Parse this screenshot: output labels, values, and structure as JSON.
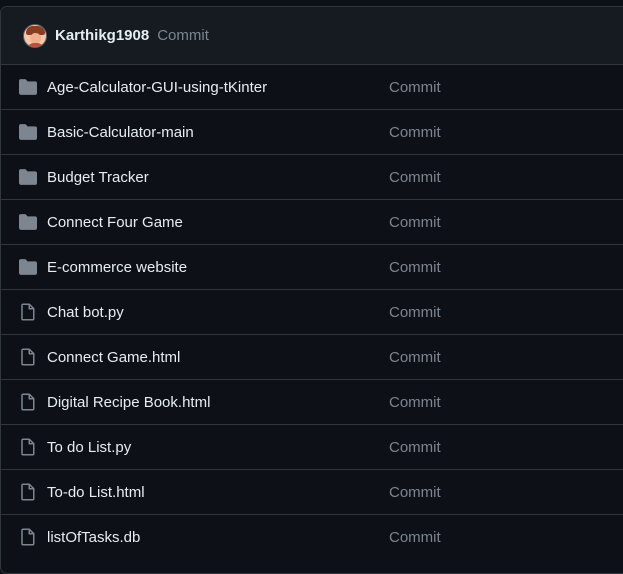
{
  "header": {
    "username": "Karthikg1908",
    "commit_label": "Commit"
  },
  "files": [
    {
      "name": "Age-Calculator-GUI-using-tKinter",
      "type": "folder",
      "commit": "Commit"
    },
    {
      "name": "Basic-Calculator-main",
      "type": "folder",
      "commit": "Commit"
    },
    {
      "name": "Budget Tracker",
      "type": "folder",
      "commit": "Commit"
    },
    {
      "name": "Connect Four Game",
      "type": "folder",
      "commit": "Commit"
    },
    {
      "name": "E-commerce website",
      "type": "folder",
      "commit": "Commit"
    },
    {
      "name": "Chat bot.py",
      "type": "file",
      "commit": "Commit"
    },
    {
      "name": "Connect Game.html",
      "type": "file",
      "commit": "Commit"
    },
    {
      "name": "Digital Recipe Book.html",
      "type": "file",
      "commit": "Commit"
    },
    {
      "name": "To do List.py",
      "type": "file",
      "commit": "Commit"
    },
    {
      "name": "To-do List.html",
      "type": "file",
      "commit": "Commit"
    },
    {
      "name": "listOfTasks.db",
      "type": "file",
      "commit": "Commit"
    }
  ],
  "colors": {
    "background": "#0d1117",
    "header_background": "#161b22",
    "border": "#30363d",
    "text": "#e6edf3",
    "muted": "#7d8590",
    "icon": "#7d8590"
  }
}
